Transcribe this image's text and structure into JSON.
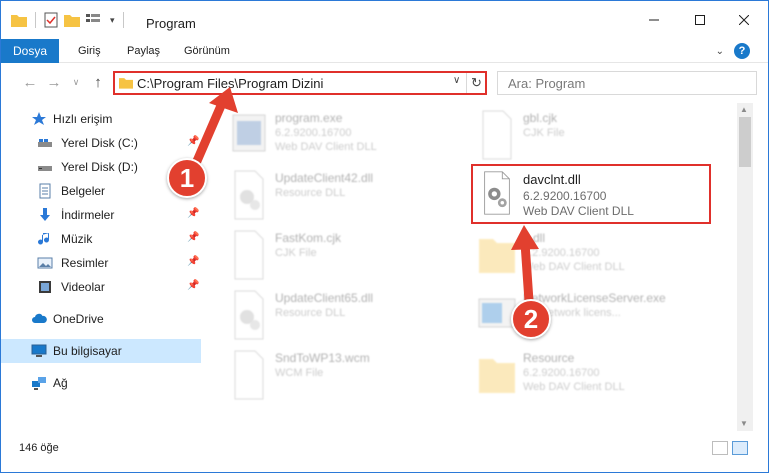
{
  "window": {
    "title": "Program"
  },
  "ribbon": {
    "tabs": [
      {
        "label": "Dosya"
      },
      {
        "label": "Giriş"
      },
      {
        "label": "Paylaş"
      },
      {
        "label": "Görünüm"
      }
    ]
  },
  "address": {
    "path": "C:\\Program Files\\Program Dizini",
    "search_placeholder": "Ara: Program"
  },
  "sidebar": {
    "items": [
      {
        "label": "Hızlı erişim",
        "icon": "star-icon"
      },
      {
        "label": "Yerel Disk (C:)",
        "icon": "drive-icon"
      },
      {
        "label": "Yerel Disk (D:)",
        "icon": "drive-icon"
      },
      {
        "label": "Belgeler",
        "icon": "documents-icon"
      },
      {
        "label": "İndirmeler",
        "icon": "download-icon"
      },
      {
        "label": "Müzik",
        "icon": "music-icon"
      },
      {
        "label": "Resimler",
        "icon": "pictures-icon"
      },
      {
        "label": "Videolar",
        "icon": "videos-icon"
      },
      {
        "label": "OneDrive",
        "icon": "cloud-icon"
      },
      {
        "label": "Bu bilgisayar",
        "icon": "computer-icon"
      },
      {
        "label": "Ağ",
        "icon": "network-icon"
      }
    ]
  },
  "files": {
    "left": [
      {
        "name": "program.exe",
        "line2": "6.2.9200.16700",
        "line3": "Web DAV Client DLL"
      },
      {
        "name": "UpdateClient42.dll",
        "line2": "Resource DLL",
        "line3": ""
      },
      {
        "name": "FastKom.cjk",
        "line2": "CJK File",
        "line3": ""
      },
      {
        "name": "UpdateClient65.dll",
        "line2": "Resource DLL",
        "line3": ""
      },
      {
        "name": "SndToWP13.wcm",
        "line2": "WCM File",
        "line3": ""
      }
    ],
    "right": [
      {
        "name": "gbl.cjk",
        "line2": "CJK File",
        "line3": ""
      },
      {
        "name": "davclnt.dll",
        "line2": "6.2.9200.16700",
        "line3": "Web DAV Client DLL"
      },
      {
        "name": "...dll",
        "line2": "6.2.9200.16700",
        "line3": "Web DAV Client DLL"
      },
      {
        "name": "NetworkLicenseServer.exe",
        "line2": "...F network licens...",
        "line3": ""
      },
      {
        "name": "Resource",
        "line2": "6.2.9200.16700",
        "line3": "Web DAV Client DLL"
      }
    ]
  },
  "callouts": {
    "one": "1",
    "two": "2"
  },
  "status": {
    "count": "146 öğe"
  },
  "colors": {
    "accent": "#1979ca",
    "highlight": "#e0302b",
    "selected": "#cce8ff"
  }
}
